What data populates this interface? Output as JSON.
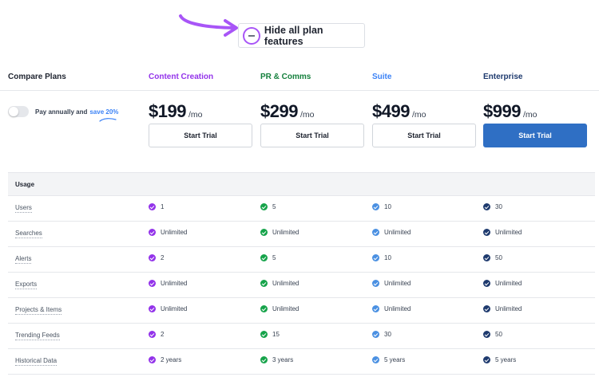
{
  "toggle_features": {
    "label": "Hide all plan features",
    "ring_color": "#a855f7",
    "arrow_color": "#a855f7"
  },
  "compare": {
    "title": "Compare Plans",
    "billing_toggle": {
      "pay_text": "Pay annually and",
      "save_text": "save 20%",
      "on": false
    }
  },
  "plans": [
    {
      "name": "Content Creation",
      "color": "#9333ea",
      "price": "$199",
      "per": "/mo",
      "cta": "Start Trial",
      "primary": false
    },
    {
      "name": "PR & Comms",
      "color": "#15803d",
      "price": "$299",
      "per": "/mo",
      "cta": "Start Trial",
      "primary": false
    },
    {
      "name": "Suite",
      "color": "#3b82f6",
      "price": "$499",
      "per": "/mo",
      "cta": "Start Trial",
      "primary": false
    },
    {
      "name": "Enterprise",
      "color": "#1e3a6e",
      "price": "$999",
      "per": "/mo",
      "cta": "Start Trial",
      "primary": true
    }
  ],
  "check_colors": [
    "#9333ea",
    "#16a34a",
    "#4a90e2",
    "#1e3a6e"
  ],
  "usage": {
    "section_label": "Usage",
    "rows": [
      {
        "feature": "Users",
        "values": [
          "1",
          "5",
          "10",
          "30"
        ]
      },
      {
        "feature": "Searches",
        "values": [
          "Unlimited",
          "Unlimited",
          "Unlimited",
          "Unlimited"
        ]
      },
      {
        "feature": "Alerts",
        "values": [
          "2",
          "5",
          "10",
          "50"
        ]
      },
      {
        "feature": "Exports",
        "values": [
          "Unlimited",
          "Unlimited",
          "Unlimited",
          "Unlimited"
        ]
      },
      {
        "feature": "Projects & Items",
        "values": [
          "Unlimited",
          "Unlimited",
          "Unlimited",
          "Unlimited"
        ]
      },
      {
        "feature": "Trending Feeds",
        "values": [
          "2",
          "15",
          "30",
          "50"
        ]
      },
      {
        "feature": "Historical Data",
        "values": [
          "2 years",
          "3 years",
          "5 years",
          "5 years"
        ]
      }
    ]
  }
}
